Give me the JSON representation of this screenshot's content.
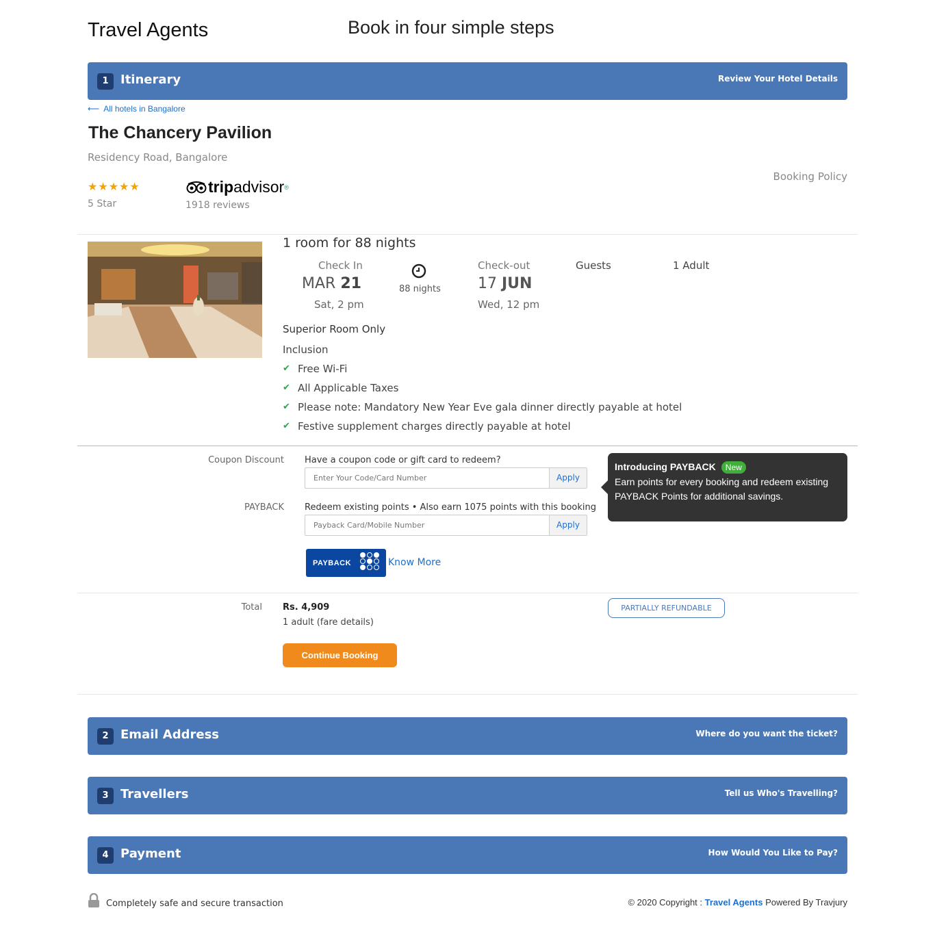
{
  "header": {
    "site_title": "Travel Agents",
    "steps_title": "Book in four simple steps"
  },
  "steps": [
    {
      "num": "1",
      "label": "Itinerary",
      "hint": "Review Your Hotel Details"
    },
    {
      "num": "2",
      "label": "Email Address",
      "hint": "Where do you want the ticket?"
    },
    {
      "num": "3",
      "label": "Travellers",
      "hint": "Tell us Who's Travelling?"
    },
    {
      "num": "4",
      "label": "Payment",
      "hint": "How Would You Like to Pay?"
    }
  ],
  "hotel": {
    "back_link": "All hotels in Bangalore",
    "name": "The Chancery Pavilion",
    "address": "Residency Road, Bangalore",
    "star_rating": 5,
    "star_label": "5 Star",
    "tripadvisor": {
      "brand_a": "trip",
      "brand_b": "advisor",
      "reviews": "1918 reviews"
    },
    "booking_policy": "Booking Policy"
  },
  "stay": {
    "room_title": "1 room for 88 nights",
    "checkin_label": "Check In",
    "checkin_month": "MAR",
    "checkin_day": "21",
    "checkin_time": "Sat, 2 pm",
    "nights": "88 nights",
    "checkout_label": "Check-out",
    "checkout_day": "17",
    "checkout_month": "JUN",
    "checkout_time": "Wed, 12 pm",
    "guests_label": "Guests",
    "guests_value": "1 Adult",
    "room_type": "Superior Room Only",
    "inclusion_title": "Inclusion",
    "inclusions": [
      "Free Wi-Fi",
      "All Applicable Taxes",
      "Please note: Mandatory New Year Eve gala dinner directly payable at hotel",
      "Festive supplement charges directly payable at hotel"
    ]
  },
  "coupon": {
    "label": "Coupon Discount",
    "caption": "Have a coupon code or gift card to redeem?",
    "placeholder": "Enter Your Code/Card Number",
    "apply": "Apply"
  },
  "payback": {
    "label": "PAYBACK",
    "caption": "Redeem existing points • Also earn 1075 points with this booking",
    "placeholder": "Payback Card/Mobile Number",
    "apply": "Apply",
    "logo_text": "PAYBACK",
    "know_more": "Know More"
  },
  "tooltip": {
    "title": "Introducing PAYBACK",
    "badge": "New",
    "body": "Earn points for every booking and redeem existing PAYBACK Points for additional savings."
  },
  "total": {
    "label": "Total",
    "amount": "Rs. 4,909",
    "sub": "1 adult (fare details)",
    "refund_badge": "PARTIALLY REFUNDABLE",
    "continue": "Continue Booking"
  },
  "footer": {
    "secure": "Completely safe and secure transaction",
    "copyright_prefix": "© 2020 Copyright :",
    "brand": "Travel Agents",
    "powered": "Powered By Travjury"
  },
  "colors": {
    "step_bar": "#4a78b6",
    "link": "#1a6fd1",
    "cta": "#f08a1c",
    "check": "#2da44e",
    "star": "#f5a300"
  },
  "icons": [
    "arrow-left-icon",
    "star-icon",
    "tripadvisor-owl-icon",
    "clock-icon",
    "check-icon",
    "lock-icon"
  ]
}
